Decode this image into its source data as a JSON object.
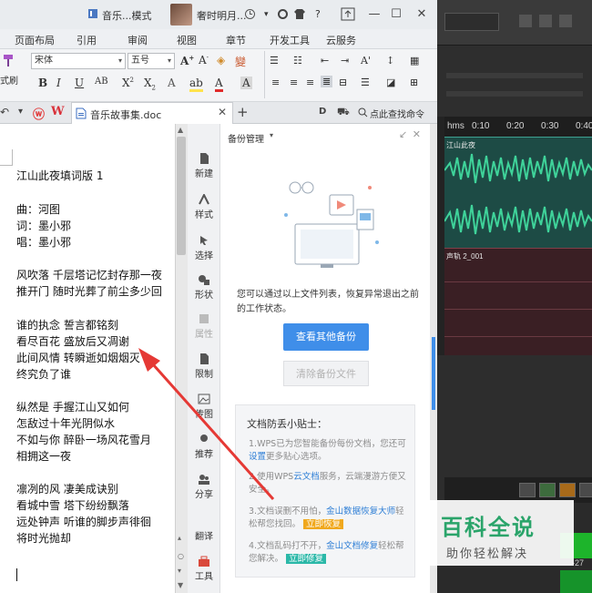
{
  "title_bar": {
    "app_label": "音乐...模式",
    "user_name": "奢时明月...",
    "help": "?",
    "minimize": "—",
    "maximize": "☐",
    "close": "✕"
  },
  "menu": [
    "页面布局",
    "引用",
    "审阅",
    "视图",
    "章节",
    "开发工具",
    "云服务"
  ],
  "ribbon": {
    "font_name": "宋体",
    "font_size": "五号",
    "style_label": "式刷"
  },
  "tabs": {
    "doc_name": "音乐故事集.doc",
    "new_tab": "+",
    "search_label": "点此查找命令"
  },
  "document": {
    "lines": [
      "江山此夜填词版 1",
      "",
      "曲：河图",
      "词：墨小邪",
      "唱：墨小邪",
      "",
      "风吹落  千层塔记忆封存那一夜",
      "推开门  随时光葬了前尘多少回",
      "",
      "谁的执念  誓言都铭刻",
      "看尽百花  盛放后又凋谢",
      "此间风情  转瞬逝如烟烟灭",
      "终究负了谁",
      "",
      "纵然是  手握江山又如何",
      "怎敌过十年光阴似水",
      "不如与你  醉卧一场风花雪月",
      "相拥这一夜",
      "",
      "凛冽的风  凄美成诀别",
      "看城中雪  塔下纷纷飘落",
      "远处钟声  听谁的脚步声徘徊",
      "将时光抛却"
    ]
  },
  "side_tools": [
    "新建",
    "样式",
    "选择",
    "形状",
    "属性",
    "限制",
    "传图",
    "推荐",
    "分享",
    "翻译",
    "工具"
  ],
  "backup_panel": {
    "title": "备份管理",
    "description": "您可以通过以上文件列表，恢复异常退出之前的工作状态。",
    "view_button": "查看其他备份",
    "clear_button": "清除备份文件",
    "tips_title": "文档防丢小贴士：",
    "tip1_a": "1.WPS已为您智能备份每份文档，您还可",
    "tip1_link": "设置",
    "tip1_b": "更多贴心选项。",
    "tip2_a": "2.使用WPS",
    "tip2_link": "云文档",
    "tip2_b": "服务，云端漫游方便又安全。",
    "tip3_a": "3.文档误删不用怕，",
    "tip3_link": "金山数据恢复大师",
    "tip3_b": "轻松帮您找回。",
    "tip3_tag": "立即恢复",
    "tip4_a": "4.文档乱码打不开，",
    "tip4_link": "金山文档修复",
    "tip4_b": "轻松帮您解决。",
    "tip4_tag": "立即修复"
  },
  "audio_editor": {
    "ruler_labels": [
      "hms",
      "0:10",
      "0:20",
      "0:30",
      "0:40"
    ],
    "track1_name": "江山此夜",
    "track2_name": "声轨 2_001",
    "time_readout": "-27"
  },
  "watermark": {
    "title": "百科全说",
    "subtitle": "助你轻松解决"
  },
  "colors": {
    "accent_blue": "#3f8ee9",
    "arrow_red": "#e53935",
    "track_green": "#3fd39a",
    "watermark_green": "#2aa46a"
  }
}
